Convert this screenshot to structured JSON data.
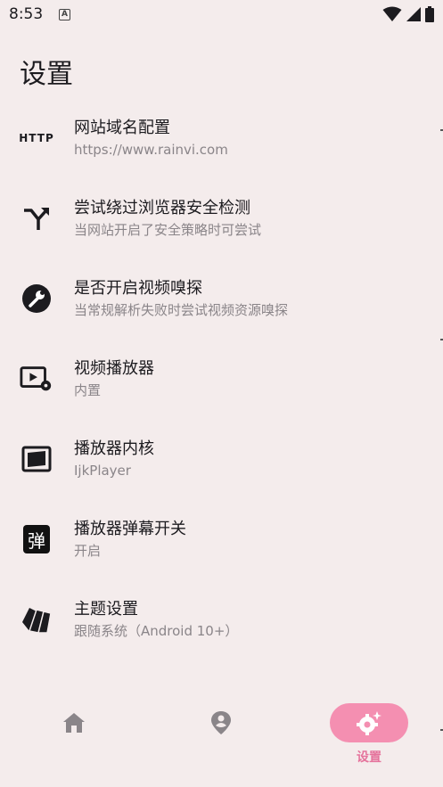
{
  "status": {
    "time": "8:53",
    "notif_letter": "A"
  },
  "page": {
    "title": "设置"
  },
  "settings": [
    {
      "icon": "http-icon",
      "icon_text": "HTTP",
      "title": "网站域名配置",
      "subtitle": "https://www.rainvi.com"
    },
    {
      "icon": "merge-arrow-icon",
      "title": "尝试绕过浏览器安全检测",
      "subtitle": "当网站开启了安全策略时可尝试"
    },
    {
      "icon": "wrench-icon",
      "title": "是否开启视频嗅探",
      "subtitle": "当常规解析失败时尝试视频资源嗅探"
    },
    {
      "icon": "video-settings-icon",
      "title": "视频播放器",
      "subtitle": "内置"
    },
    {
      "icon": "player-core-icon",
      "title": "播放器内核",
      "subtitle": "IjkPlayer"
    },
    {
      "icon": "danmaku-icon",
      "icon_text": "弹",
      "title": "播放器弹幕开关",
      "subtitle": "开启"
    },
    {
      "icon": "theme-cards-icon",
      "title": "主题设置",
      "subtitle": "跟随系统（Android 10+）"
    }
  ],
  "bottom_nav": {
    "settings_label": "设置"
  },
  "colors": {
    "background": "#f4ecec",
    "accent": "#f48fb1",
    "accent_text": "#e5739c",
    "subtitle": "#8a8589"
  }
}
